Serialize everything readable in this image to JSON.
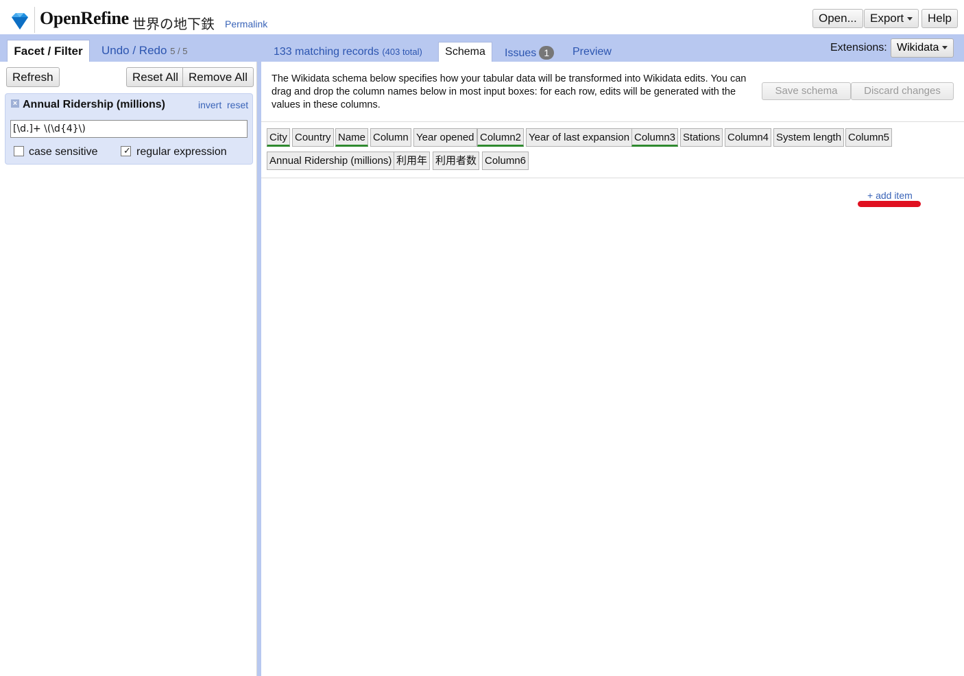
{
  "header": {
    "app_name": "OpenRefine",
    "project_name": "世界の地下鉄",
    "permalink": "Permalink",
    "buttons": {
      "open": "Open...",
      "export": "Export",
      "help": "Help"
    }
  },
  "left_panel": {
    "tabs": {
      "facet_filter": "Facet / Filter",
      "undo_redo": "Undo / Redo",
      "undo_count": "5 / 5"
    },
    "buttons": {
      "refresh": "Refresh",
      "reset_all": "Reset All",
      "remove_all": "Remove All"
    },
    "facet": {
      "close": "×",
      "title": "Annual Ridership (millions)",
      "invert": "invert",
      "reset": "reset",
      "value": "[\\d.]+ \\(\\d{4}\\)",
      "case_sensitive": {
        "label": "case sensitive",
        "checked": false
      },
      "regular_expression": {
        "label": "regular expression",
        "checked": true,
        "mark": "✓"
      }
    }
  },
  "right_panel": {
    "matching": "133 matching records",
    "total": "(403 total)",
    "tabs": {
      "schema": "Schema",
      "issues": "Issues",
      "issues_count": "1",
      "preview": "Preview"
    },
    "extensions_label": "Extensions:",
    "extensions_menu": "Wikidata",
    "schema_description": "The Wikidata schema below specifies how your tabular data will be transformed into Wikidata edits. You can drag and drop the column names below in most input boxes: for each row, edits will be generated with the values in these columns.",
    "save_schema": "Save schema",
    "discard_changes": "Discard changes",
    "columns": [
      {
        "name": "City",
        "used": true
      },
      {
        "name": "Country",
        "used": false
      },
      {
        "name": "Name",
        "used": true
      },
      {
        "name": "Column",
        "used": false
      },
      {
        "name": "Year opened",
        "used": false
      },
      {
        "name": "Column2",
        "used": true
      },
      {
        "name": "Year of last expansion",
        "used": false
      },
      {
        "name": "Column3",
        "used": true
      },
      {
        "name": "Stations",
        "used": false
      },
      {
        "name": "Column4",
        "used": false
      },
      {
        "name": "System length",
        "used": false
      },
      {
        "name": "Column5",
        "used": false
      },
      {
        "name": "Annual Ridership (millions)",
        "used": false
      },
      {
        "name": "利用年",
        "used": false
      },
      {
        "name": "利用者数",
        "used": false
      },
      {
        "name": "Column6",
        "used": false
      }
    ],
    "add_item": "+ add item"
  },
  "colors": {
    "accent_blue": "#b8c8f0",
    "link_blue": "#2c55b0",
    "used_green": "#2f8a2f",
    "annotation_red": "#e01020"
  }
}
